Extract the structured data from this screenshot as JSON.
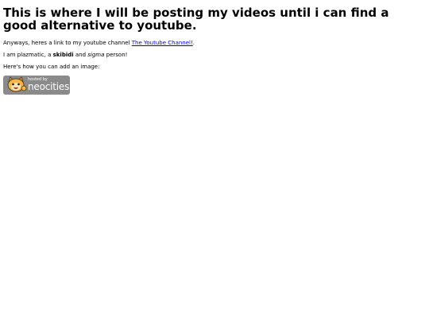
{
  "heading": "This is where I will be posting my videos until i can find a good alternative to youtube.",
  "intro": {
    "before_link": "Anyways, heres a link to my youtube channel ",
    "link_text": "The Youtube Channel!",
    "after_link": "."
  },
  "about": {
    "before_bold": "I am plazmatic, a ",
    "bold": "skibidi",
    "middle": " and ",
    "italic": "sigma",
    "after": " person!"
  },
  "image_hint": "Here's how you can add an image:",
  "badge": {
    "small_text": "hosted by",
    "big_text": "neocities",
    "icon": "neocities-cat-mascot-icon",
    "background_color": "#8a8a8a"
  },
  "colors": {
    "link": "#0000ee",
    "text": "#000000",
    "background": "#ffffff"
  }
}
